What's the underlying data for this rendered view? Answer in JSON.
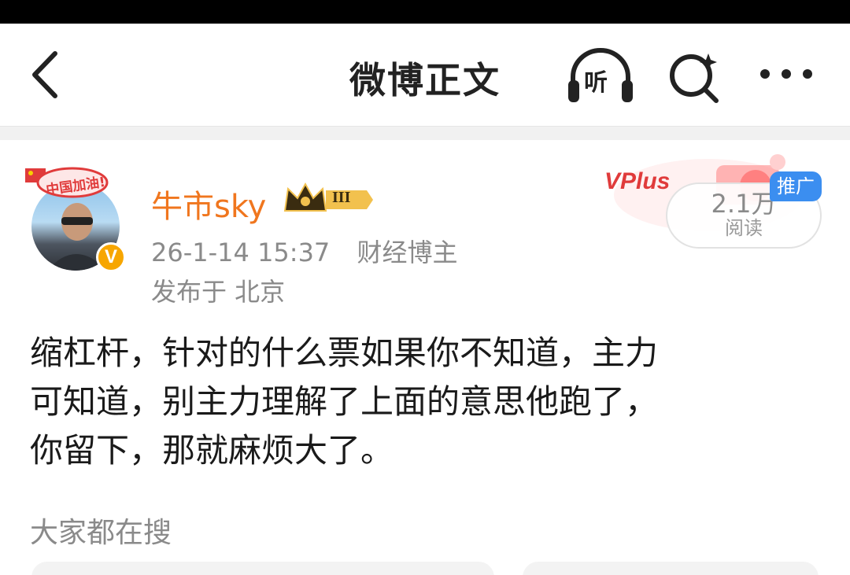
{
  "header": {
    "title": "微博正文",
    "listen_label": "听"
  },
  "post": {
    "author": "牛市sky",
    "level_badge": "III",
    "avatar_badge_text": "中国加油!",
    "verified_mark": "V",
    "timestamp": "26-1-14 15:37",
    "category": "财经博主",
    "location": "发布于 北京",
    "ad": {
      "brand": "VPlus",
      "reads_count": "2.1万",
      "reads_label": "阅读",
      "promo_badge": "推广"
    },
    "content_lines": [
      "缩杠杆，针对的什么票如果你不知道，主力",
      "可知道，别主力理解了上面的意思他跑了，",
      "你留下，那就麻烦大了。"
    ]
  },
  "related_search": {
    "label": "大家都在搜"
  },
  "icons": {
    "back": "back-arrow-icon",
    "listen": "headphones-icon",
    "search": "ai-search-icon",
    "more": "more-dots-icon",
    "crown": "crown-level-icon",
    "verified": "verified-v-icon"
  },
  "colors": {
    "username": "#f0761e",
    "promo_badge": "#3b8ef0",
    "verified": "#f7a600",
    "secondary_text": "#8a8a8a"
  }
}
